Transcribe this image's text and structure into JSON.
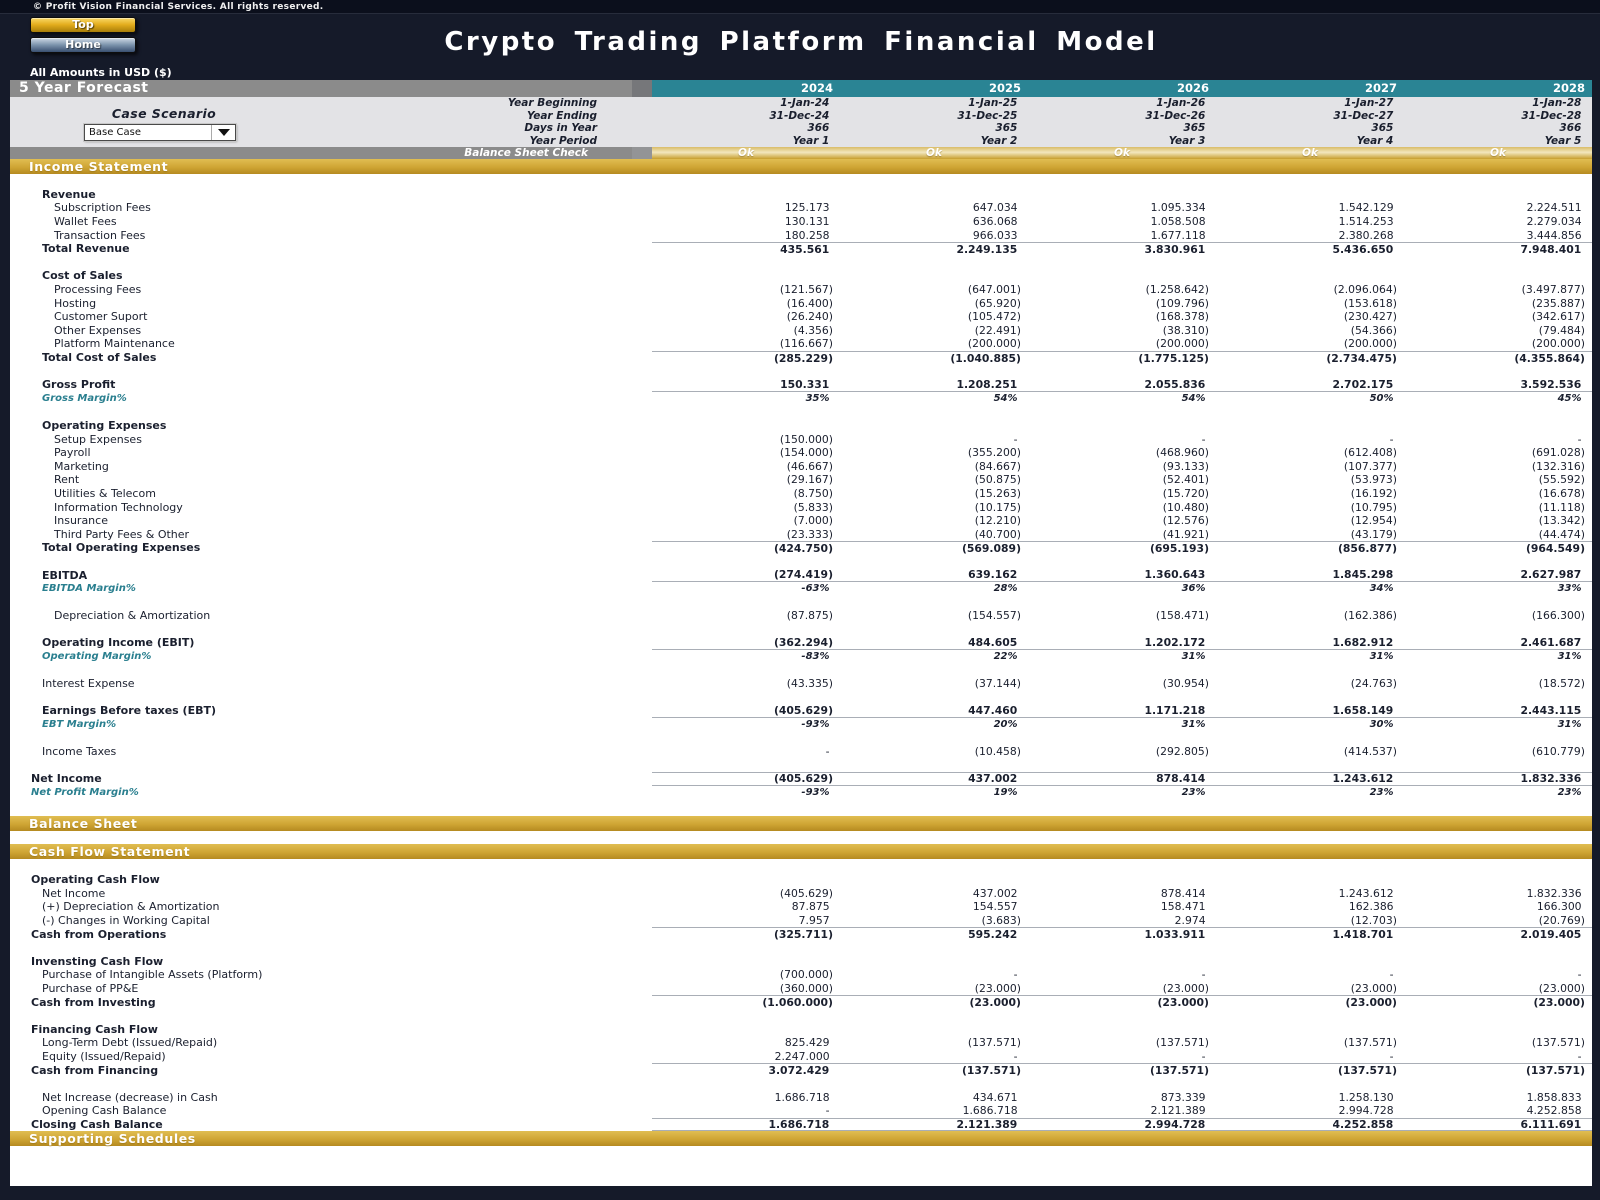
{
  "page": {
    "copyright": "© Profit Vision Financial Services. All rights reserved.",
    "title": "Crypto Trading Platform Financial Model",
    "amounts_note": "All Amounts in  USD ($)",
    "buttons": {
      "top": "Top",
      "home": "Home"
    }
  },
  "colors": {
    "background": "#151a29",
    "teal_year_header": "#2a8494",
    "gold_section_bar": "#cfa534",
    "gray_header_bar": "#8b8b8b",
    "margin_label_teal": "#2a7f8f"
  },
  "forecast": {
    "title": "5 Year Forecast",
    "case_scenario": {
      "label": "Case Scenario",
      "selected": "Base Case"
    },
    "years": [
      "2024",
      "2025",
      "2026",
      "2027",
      "2028"
    ],
    "meta_rows": [
      {
        "label": "Year Beginning",
        "values": [
          "1-Jan-24",
          "1-Jan-25",
          "1-Jan-26",
          "1-Jan-27",
          "1-Jan-28"
        ]
      },
      {
        "label": "Year Ending",
        "values": [
          "31-Dec-24",
          "31-Dec-25",
          "31-Dec-26",
          "31-Dec-27",
          "31-Dec-28"
        ]
      },
      {
        "label": "Days in Year",
        "values": [
          "366",
          "365",
          "365",
          "365",
          "366"
        ]
      },
      {
        "label": "Year Period",
        "values": [
          "Year 1",
          "Year 2",
          "Year 3",
          "Year 4",
          "Year 5"
        ]
      }
    ],
    "check_row": {
      "label": "Balance Sheet Check",
      "values": [
        "Ok",
        "Ok",
        "Ok",
        "Ok",
        "Ok"
      ]
    }
  },
  "income_statement": {
    "section_title": "Income Statement",
    "rows": [
      {
        "style": "spacer"
      },
      {
        "style": "header",
        "ind": 1,
        "label": "Revenue"
      },
      {
        "style": "item",
        "ind": 2,
        "label": "Subscription Fees",
        "values": [
          "125.173",
          "647.034",
          "1.095.334",
          "1.542.129",
          "2.224.511"
        ]
      },
      {
        "style": "item",
        "ind": 2,
        "label": "Wallet Fees",
        "values": [
          "130.131",
          "636.068",
          "1.058.508",
          "1.514.253",
          "2.279.034"
        ]
      },
      {
        "style": "item",
        "ind": 2,
        "label": "Transaction Fees",
        "values": [
          "180.258",
          "966.033",
          "1.677.118",
          "2.380.268",
          "3.444.856"
        ]
      },
      {
        "style": "total",
        "ind": 1,
        "label": "Total Revenue",
        "values": [
          "435.561",
          "2.249.135",
          "3.830.961",
          "5.436.650",
          "7.948.401"
        ]
      },
      {
        "style": "spacer"
      },
      {
        "style": "header",
        "ind": 1,
        "label": "Cost of Sales"
      },
      {
        "style": "item",
        "ind": 2,
        "label": "Processing Fees",
        "values": [
          "(121.567)",
          "(647.001)",
          "(1.258.642)",
          "(2.096.064)",
          "(3.497.877)"
        ]
      },
      {
        "style": "item",
        "ind": 2,
        "label": "Hosting",
        "values": [
          "(16.400)",
          "(65.920)",
          "(109.796)",
          "(153.618)",
          "(235.887)"
        ]
      },
      {
        "style": "item",
        "ind": 2,
        "label": "Customer Suport",
        "values": [
          "(26.240)",
          "(105.472)",
          "(168.378)",
          "(230.427)",
          "(342.617)"
        ]
      },
      {
        "style": "item",
        "ind": 2,
        "label": "Other Expenses",
        "values": [
          "(4.356)",
          "(22.491)",
          "(38.310)",
          "(54.366)",
          "(79.484)"
        ]
      },
      {
        "style": "item",
        "ind": 2,
        "label": "Platform Maintenance",
        "values": [
          "(116.667)",
          "(200.000)",
          "(200.000)",
          "(200.000)",
          "(200.000)"
        ]
      },
      {
        "style": "total",
        "ind": 1,
        "label": "Total Cost of Sales",
        "values": [
          "(285.229)",
          "(1.040.885)",
          "(1.775.125)",
          "(2.734.475)",
          "(4.355.864)"
        ]
      },
      {
        "style": "spacer"
      },
      {
        "style": "summary",
        "ind": 1,
        "label": "Gross Profit",
        "values": [
          "150.331",
          "1.208.251",
          "2.055.836",
          "2.702.175",
          "3.592.536"
        ]
      },
      {
        "style": "margin",
        "ind": 1,
        "label": "Gross Margin%",
        "values": [
          "35%",
          "54%",
          "54%",
          "50%",
          "45%"
        ]
      },
      {
        "style": "spacer"
      },
      {
        "style": "header",
        "ind": 1,
        "label": "Operating Expenses"
      },
      {
        "style": "item",
        "ind": 2,
        "label": "Setup Expenses",
        "values": [
          "(150.000)",
          "-",
          "-",
          "-",
          "-"
        ]
      },
      {
        "style": "item",
        "ind": 2,
        "label": "Payroll",
        "values": [
          "(154.000)",
          "(355.200)",
          "(468.960)",
          "(612.408)",
          "(691.028)"
        ]
      },
      {
        "style": "item",
        "ind": 2,
        "label": "Marketing",
        "values": [
          "(46.667)",
          "(84.667)",
          "(93.133)",
          "(107.377)",
          "(132.316)"
        ]
      },
      {
        "style": "item",
        "ind": 2,
        "label": "Rent",
        "values": [
          "(29.167)",
          "(50.875)",
          "(52.401)",
          "(53.973)",
          "(55.592)"
        ]
      },
      {
        "style": "item",
        "ind": 2,
        "label": "Utilities & Telecom",
        "values": [
          "(8.750)",
          "(15.263)",
          "(15.720)",
          "(16.192)",
          "(16.678)"
        ]
      },
      {
        "style": "item",
        "ind": 2,
        "label": "Information Technology",
        "values": [
          "(5.833)",
          "(10.175)",
          "(10.480)",
          "(10.795)",
          "(11.118)"
        ]
      },
      {
        "style": "item",
        "ind": 2,
        "label": "Insurance",
        "values": [
          "(7.000)",
          "(12.210)",
          "(12.576)",
          "(12.954)",
          "(13.342)"
        ]
      },
      {
        "style": "item",
        "ind": 2,
        "label": "Third Party Fees & Other",
        "values": [
          "(23.333)",
          "(40.700)",
          "(41.921)",
          "(43.179)",
          "(44.474)"
        ]
      },
      {
        "style": "total",
        "ind": 1,
        "label": "Total Operating Expenses",
        "values": [
          "(424.750)",
          "(569.089)",
          "(695.193)",
          "(856.877)",
          "(964.549)"
        ]
      },
      {
        "style": "spacer"
      },
      {
        "style": "summary",
        "ind": 1,
        "label": "EBITDA",
        "values": [
          "(274.419)",
          "639.162",
          "1.360.643",
          "1.845.298",
          "2.627.987"
        ]
      },
      {
        "style": "margin",
        "ind": 1,
        "label": "EBITDA Margin%",
        "values": [
          "-63%",
          "28%",
          "36%",
          "34%",
          "33%"
        ]
      },
      {
        "style": "spacer"
      },
      {
        "style": "item",
        "ind": 2,
        "label": "Depreciation & Amortization",
        "values": [
          "(87.875)",
          "(154.557)",
          "(158.471)",
          "(162.386)",
          "(166.300)"
        ]
      },
      {
        "style": "spacer"
      },
      {
        "style": "summary",
        "ind": 1,
        "label": "Operating Income (EBIT)",
        "values": [
          "(362.294)",
          "484.605",
          "1.202.172",
          "1.682.912",
          "2.461.687"
        ]
      },
      {
        "style": "margin",
        "ind": 1,
        "label": "Operating Margin%",
        "values": [
          "-83%",
          "22%",
          "31%",
          "31%",
          "31%"
        ]
      },
      {
        "style": "spacer"
      },
      {
        "style": "item",
        "ind": 1,
        "label": "Interest Expense",
        "values": [
          "(43.335)",
          "(37.144)",
          "(30.954)",
          "(24.763)",
          "(18.572)"
        ]
      },
      {
        "style": "spacer"
      },
      {
        "style": "summary",
        "ind": 1,
        "label": "Earnings Before taxes (EBT)",
        "values": [
          "(405.629)",
          "447.460",
          "1.171.218",
          "1.658.149",
          "2.443.115"
        ]
      },
      {
        "style": "margin",
        "ind": 1,
        "label": "EBT Margin%",
        "values": [
          "-93%",
          "20%",
          "31%",
          "30%",
          "31%"
        ]
      },
      {
        "style": "spacer"
      },
      {
        "style": "item",
        "ind": 1,
        "label": "Income Taxes",
        "values": [
          "-",
          "(10.458)",
          "(292.805)",
          "(414.537)",
          "(610.779)"
        ]
      },
      {
        "style": "spacer"
      },
      {
        "style": "totalb",
        "ind": 0,
        "label": "Net Income",
        "values": [
          "(405.629)",
          "437.002",
          "878.414",
          "1.243.612",
          "1.832.336"
        ]
      },
      {
        "style": "margin",
        "ind": 0,
        "label": "Net Profit Margin%",
        "values": [
          "-93%",
          "19%",
          "23%",
          "23%",
          "23%"
        ]
      }
    ]
  },
  "balance_sheet": {
    "section_title": "Balance Sheet"
  },
  "cash_flow": {
    "section_title": "Cash Flow Statement",
    "rows": [
      {
        "style": "spacer"
      },
      {
        "style": "header",
        "ind": 0,
        "label": "Operating Cash Flow"
      },
      {
        "style": "item",
        "ind": 1,
        "label": "Net Income",
        "values": [
          "(405.629)",
          "437.002",
          "878.414",
          "1.243.612",
          "1.832.336"
        ]
      },
      {
        "style": "item",
        "ind": 1,
        "label": "(+) Depreciation & Amortization",
        "values": [
          "87.875",
          "154.557",
          "158.471",
          "162.386",
          "166.300"
        ]
      },
      {
        "style": "item",
        "ind": 1,
        "label": "(-) Changes in Working Capital",
        "values": [
          "7.957",
          "(3.683)",
          "2.974",
          "(12.703)",
          "(20.769)"
        ]
      },
      {
        "style": "total",
        "ind": 0,
        "label": "Cash from Operations",
        "values": [
          "(325.711)",
          "595.242",
          "1.033.911",
          "1.418.701",
          "2.019.405"
        ]
      },
      {
        "style": "spacer"
      },
      {
        "style": "header",
        "ind": 0,
        "label": "Invensting Cash Flow"
      },
      {
        "style": "item",
        "ind": 1,
        "label": "Purchase of Intangible Assets (Platform)",
        "values": [
          "(700.000)",
          "-",
          "-",
          "-",
          "-"
        ]
      },
      {
        "style": "item",
        "ind": 1,
        "label": "Purchase of PP&E",
        "values": [
          "(360.000)",
          "(23.000)",
          "(23.000)",
          "(23.000)",
          "(23.000)"
        ]
      },
      {
        "style": "total",
        "ind": 0,
        "label": "Cash from Investing",
        "values": [
          "(1.060.000)",
          "(23.000)",
          "(23.000)",
          "(23.000)",
          "(23.000)"
        ]
      },
      {
        "style": "spacer"
      },
      {
        "style": "header",
        "ind": 0,
        "label": "Financing Cash Flow"
      },
      {
        "style": "item",
        "ind": 1,
        "label": "Long-Term Debt (Issued/Repaid)",
        "values": [
          "825.429",
          "(137.571)",
          "(137.571)",
          "(137.571)",
          "(137.571)"
        ]
      },
      {
        "style": "item",
        "ind": 1,
        "label": "Equity (Issued/Repaid)",
        "values": [
          "2.247.000",
          "-",
          "-",
          "-",
          "-"
        ]
      },
      {
        "style": "total",
        "ind": 0,
        "label": "Cash from Financing",
        "values": [
          "3.072.429",
          "(137.571)",
          "(137.571)",
          "(137.571)",
          "(137.571)"
        ]
      },
      {
        "style": "spacer"
      },
      {
        "style": "item",
        "ind": 1,
        "label": "Net Increase (decrease) in Cash",
        "values": [
          "1.686.718",
          "434.671",
          "873.339",
          "1.258.130",
          "1.858.833"
        ]
      },
      {
        "style": "item",
        "ind": 1,
        "label": "Opening Cash Balance",
        "values": [
          "-",
          "1.686.718",
          "2.121.389",
          "2.994.728",
          "4.252.858"
        ]
      },
      {
        "style": "totalb",
        "ind": 0,
        "label": "Closing Cash Balance",
        "values": [
          "1.686.718",
          "2.121.389",
          "2.994.728",
          "4.252.858",
          "6.111.691"
        ]
      }
    ]
  },
  "supporting": {
    "section_title": "Supporting Schedules"
  }
}
